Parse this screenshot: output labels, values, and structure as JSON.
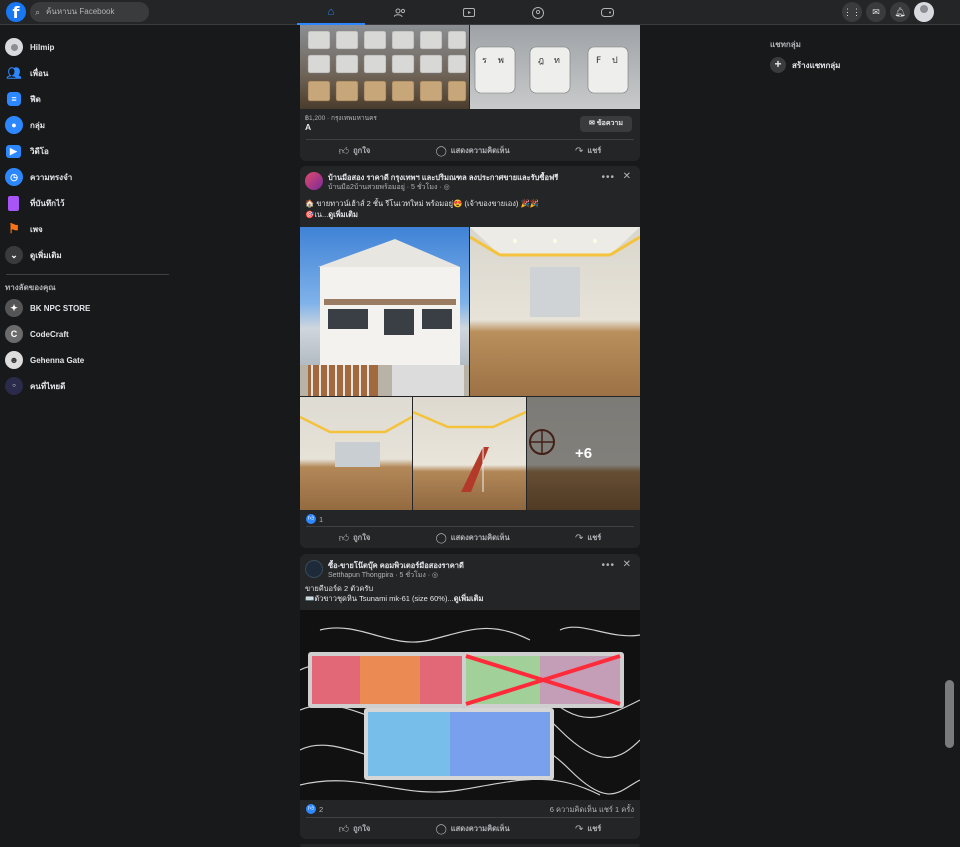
{
  "topbar": {
    "logo": "f",
    "search_placeholder": "ค้นหาบน Facebook",
    "nav_icons": [
      "home-icon",
      "friends-icon",
      "watch-icon",
      "groups-icon",
      "gaming-icon"
    ],
    "right_icons": [
      "menu-grid-icon",
      "messenger-icon",
      "notifications-icon",
      "profile-avatar"
    ],
    "accent": "#2d88ff"
  },
  "sidebar": {
    "items": [
      {
        "label": "Hilmip",
        "icon": "profile-avatar",
        "color": "#d8dadf"
      },
      {
        "label": "เพื่อน",
        "icon": "friends-icon",
        "color": "#2d88ff"
      },
      {
        "label": "ฟีด",
        "icon": "feed-icon",
        "color": "#2d88ff"
      },
      {
        "label": "กลุ่ม",
        "icon": "groups-icon",
        "color": "#2d88ff"
      },
      {
        "label": "วิดีโอ",
        "icon": "video-icon",
        "color": "#2d88ff"
      },
      {
        "label": "ความทรงจำ",
        "icon": "memories-icon",
        "color": "#2d88ff"
      },
      {
        "label": "ที่บันทึกไว้",
        "icon": "saved-icon",
        "color": "#a855f7"
      },
      {
        "label": "เพจ",
        "icon": "pages-icon",
        "color": "#f97316"
      },
      {
        "label": "ดูเพิ่มเติม",
        "icon": "chevron-down-icon",
        "color": "#3a3b3c"
      }
    ],
    "shortcuts_heading": "ทางลัดของคุณ",
    "shortcuts": [
      {
        "label": "BK NPC STORE",
        "color": "#555"
      },
      {
        "label": "CodeCraft",
        "color": "#6b6b6b"
      },
      {
        "label": "Gehenna Gate",
        "color": "#ddd"
      },
      {
        "label": "คนที่ไทยดี",
        "color": "#2a2a4a"
      }
    ]
  },
  "rightcol": {
    "title": "แชทกลุ่ม",
    "create_label": "สร้างแชทกลุ่ม"
  },
  "posts": [
    {
      "price_location": "฿1,200 · กรุงเทพมหานคร",
      "item_title": "A",
      "message_button": "ข้อความ",
      "actions": {
        "like": "ถูกใจ",
        "comment": "แสดงความคิดเห็น",
        "share": "แชร์"
      }
    },
    {
      "name": "บ้านมือสอง ราคาดี กรุงเทพฯ และปริมณฑล ลงประกาศขายและรับซื้อฟรี",
      "meta": "บ้านมือ2บ้านสวยพร้อมอยู่ · 5 ชั่วโมง · ◎",
      "text_line1": "🏠 ขายทาวน์เฮ้าส์ 2 ชั้น รีโนเวทใหม่ พร้อมอยู่😍 (เจ้าของขายเอง) 🎉🎉",
      "text_line2_prefix": "🎯เน...",
      "see_more": "ดูเพิ่มเติม",
      "plus_more": "+6",
      "like_count": "1",
      "actions": {
        "like": "ถูกใจ",
        "comment": "แสดงความคิดเห็น",
        "share": "แชร์"
      }
    },
    {
      "name": "ซื้อ-ขายโน๊ตบุ๊ค คอมพิวเตอร์มือสองราคาดี",
      "meta": "Setthapun Thongpira · 5 ชั่วโมง · ◎",
      "text_line1": "ขายคีบอร์ด 2 ตัวครับ",
      "text_line2_prefix": "⌨️ตัวขาวชุดหิน Tsunami mk-61 (size 60%)...",
      "see_more": "ดูเพิ่มเติม",
      "like_count": "2",
      "counts": "6 ความคิดเห็น  แชร์ 1 ครั้ง",
      "actions": {
        "like": "ถูกใจ",
        "comment": "แสดงความคิดเห็น",
        "share": "แชร์"
      }
    }
  ]
}
